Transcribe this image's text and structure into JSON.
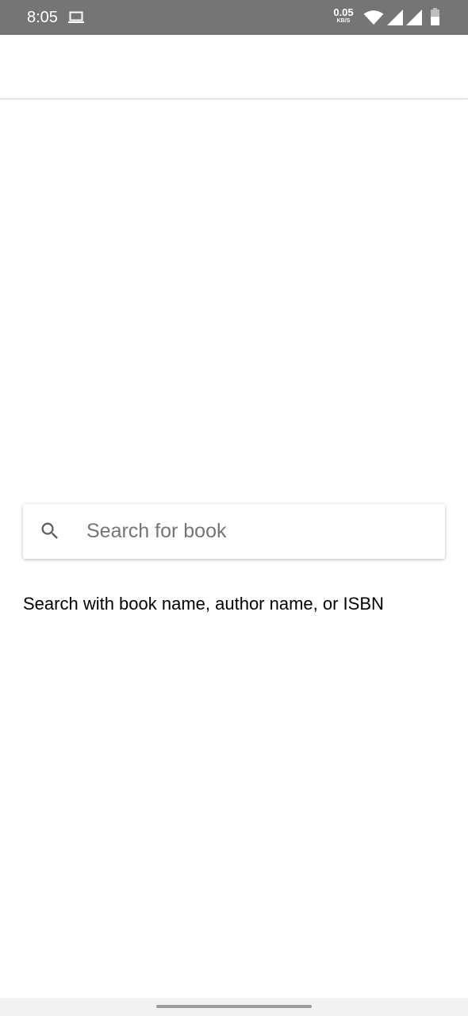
{
  "status_bar": {
    "time": "8:05",
    "net_speed_value": "0.05",
    "net_speed_unit": "KB/S",
    "background_color": "#757575",
    "icons": [
      "laptop-icon",
      "wifi-icon",
      "signal-icon",
      "signal-icon",
      "battery-icon"
    ]
  },
  "search": {
    "placeholder": "Search for book",
    "value": "",
    "icon": "search-icon"
  },
  "helper_text": "Search with book name, author name, or ISBN",
  "colors": {
    "placeholder": "#757575",
    "icon": "#616161"
  }
}
